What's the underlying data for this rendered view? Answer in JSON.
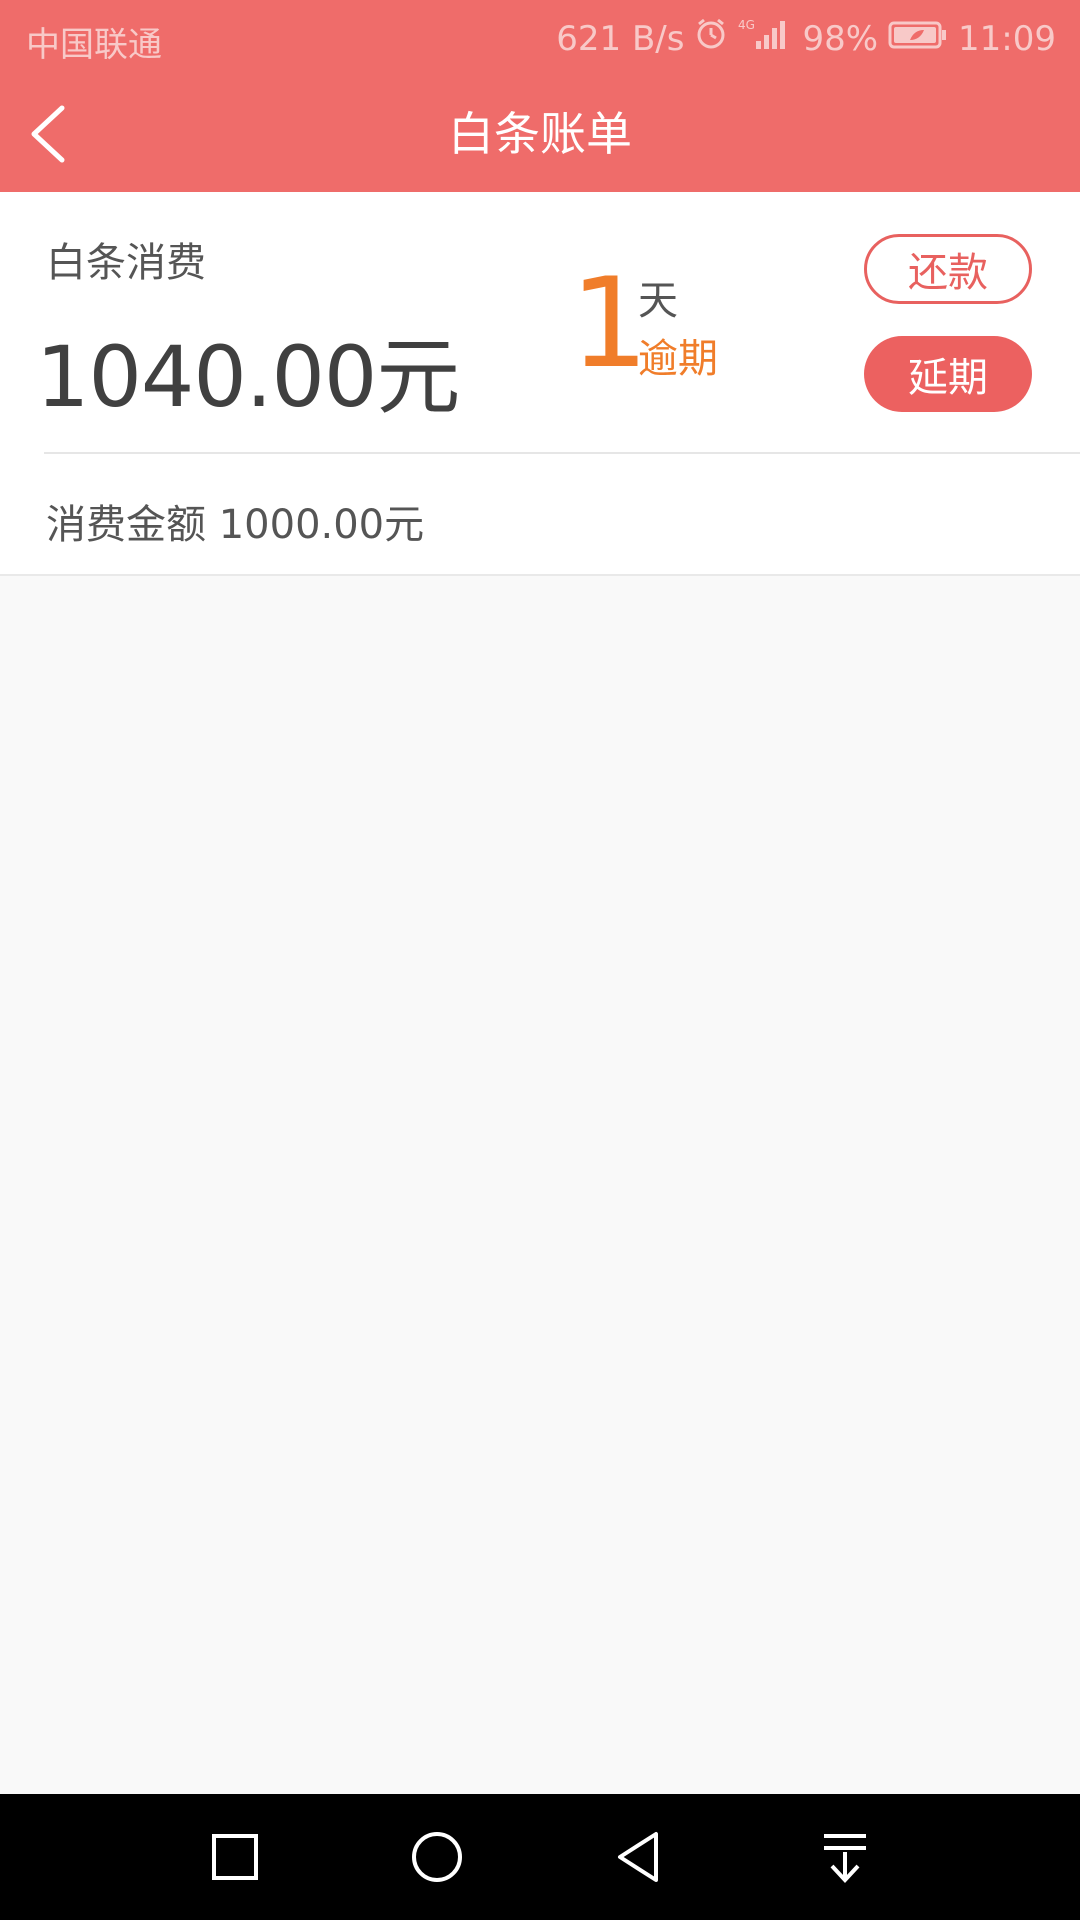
{
  "status_bar": {
    "carrier": "中国联通",
    "speed": "621 B/s",
    "network": "4G",
    "battery": "98%",
    "time": "11:09"
  },
  "app_bar": {
    "title": "白条账单",
    "back_icon": "back-arrow-icon"
  },
  "bill": {
    "label": "白条消费",
    "amount": "1040.00元",
    "days": "1",
    "days_unit": "天",
    "status": "逾期",
    "repay_label": "还款",
    "extend_label": "延期",
    "detail_label": "消费金额",
    "detail_value": "1000.00元"
  },
  "nav_bar": {
    "icons": [
      "recent-apps-icon",
      "home-icon",
      "back-icon",
      "notification-pulldown-icon"
    ]
  },
  "colors": {
    "header": "#ef6c6a",
    "accent": "#ec6160",
    "overdue": "#f07d2a"
  }
}
